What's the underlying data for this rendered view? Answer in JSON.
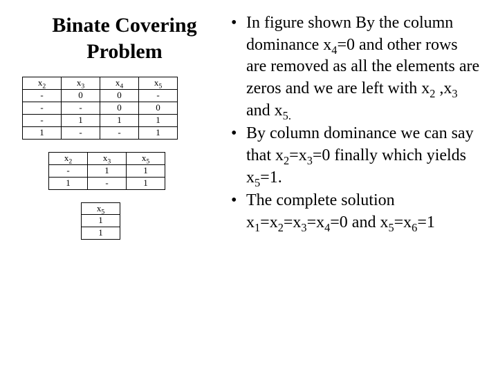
{
  "title_line1": "Binate Covering",
  "title_line2": "Problem",
  "tables": {
    "t1": {
      "headers": [
        "x",
        "x",
        "x",
        "x"
      ],
      "header_subs": [
        "2",
        "3",
        "4",
        "5"
      ],
      "rows": [
        [
          "-",
          "0",
          "0",
          "-"
        ],
        [
          "-",
          "-",
          "0",
          "0"
        ],
        [
          "-",
          "1",
          "1",
          "1"
        ],
        [
          "1",
          "-",
          "-",
          "1"
        ]
      ]
    },
    "t2": {
      "headers": [
        "x",
        "x",
        "x"
      ],
      "header_subs": [
        "2",
        "3",
        "5"
      ],
      "rows": [
        [
          "-",
          "1",
          "1"
        ],
        [
          "1",
          "-",
          "1"
        ]
      ]
    },
    "t3": {
      "headers": [
        "x"
      ],
      "header_subs": [
        "5"
      ],
      "rows": [
        [
          "1"
        ],
        [
          "1"
        ]
      ]
    }
  },
  "bullets": {
    "b1": {
      "s1": "In figure shown By the column dominance x",
      "sub1": "4",
      "s2": "=0 and other rows are removed as all the elements are zeros and  we are left with x",
      "sub2": "2",
      "s3": " ,x",
      "sub3": "3",
      "s4": " and x",
      "sub4": "5.",
      "s5": ""
    },
    "b2": {
      "s1": " By column dominance we can say that x",
      "sub1": "2",
      "s2": "=x",
      "sub2": "3",
      "s3": "=0 finally which yields x",
      "sub3": "5",
      "s4": "=1."
    },
    "b3": {
      "s1": "The complete solution x",
      "sub1": "1",
      "s2": "=x",
      "sub2": "2",
      "s3": "=x",
      "sub3": "3",
      "s4": "=x",
      "sub4": "4",
      "s5": "=0 and x",
      "sub5": "5",
      "s6": "=x",
      "sub6": "6",
      "s7": "=1"
    }
  }
}
